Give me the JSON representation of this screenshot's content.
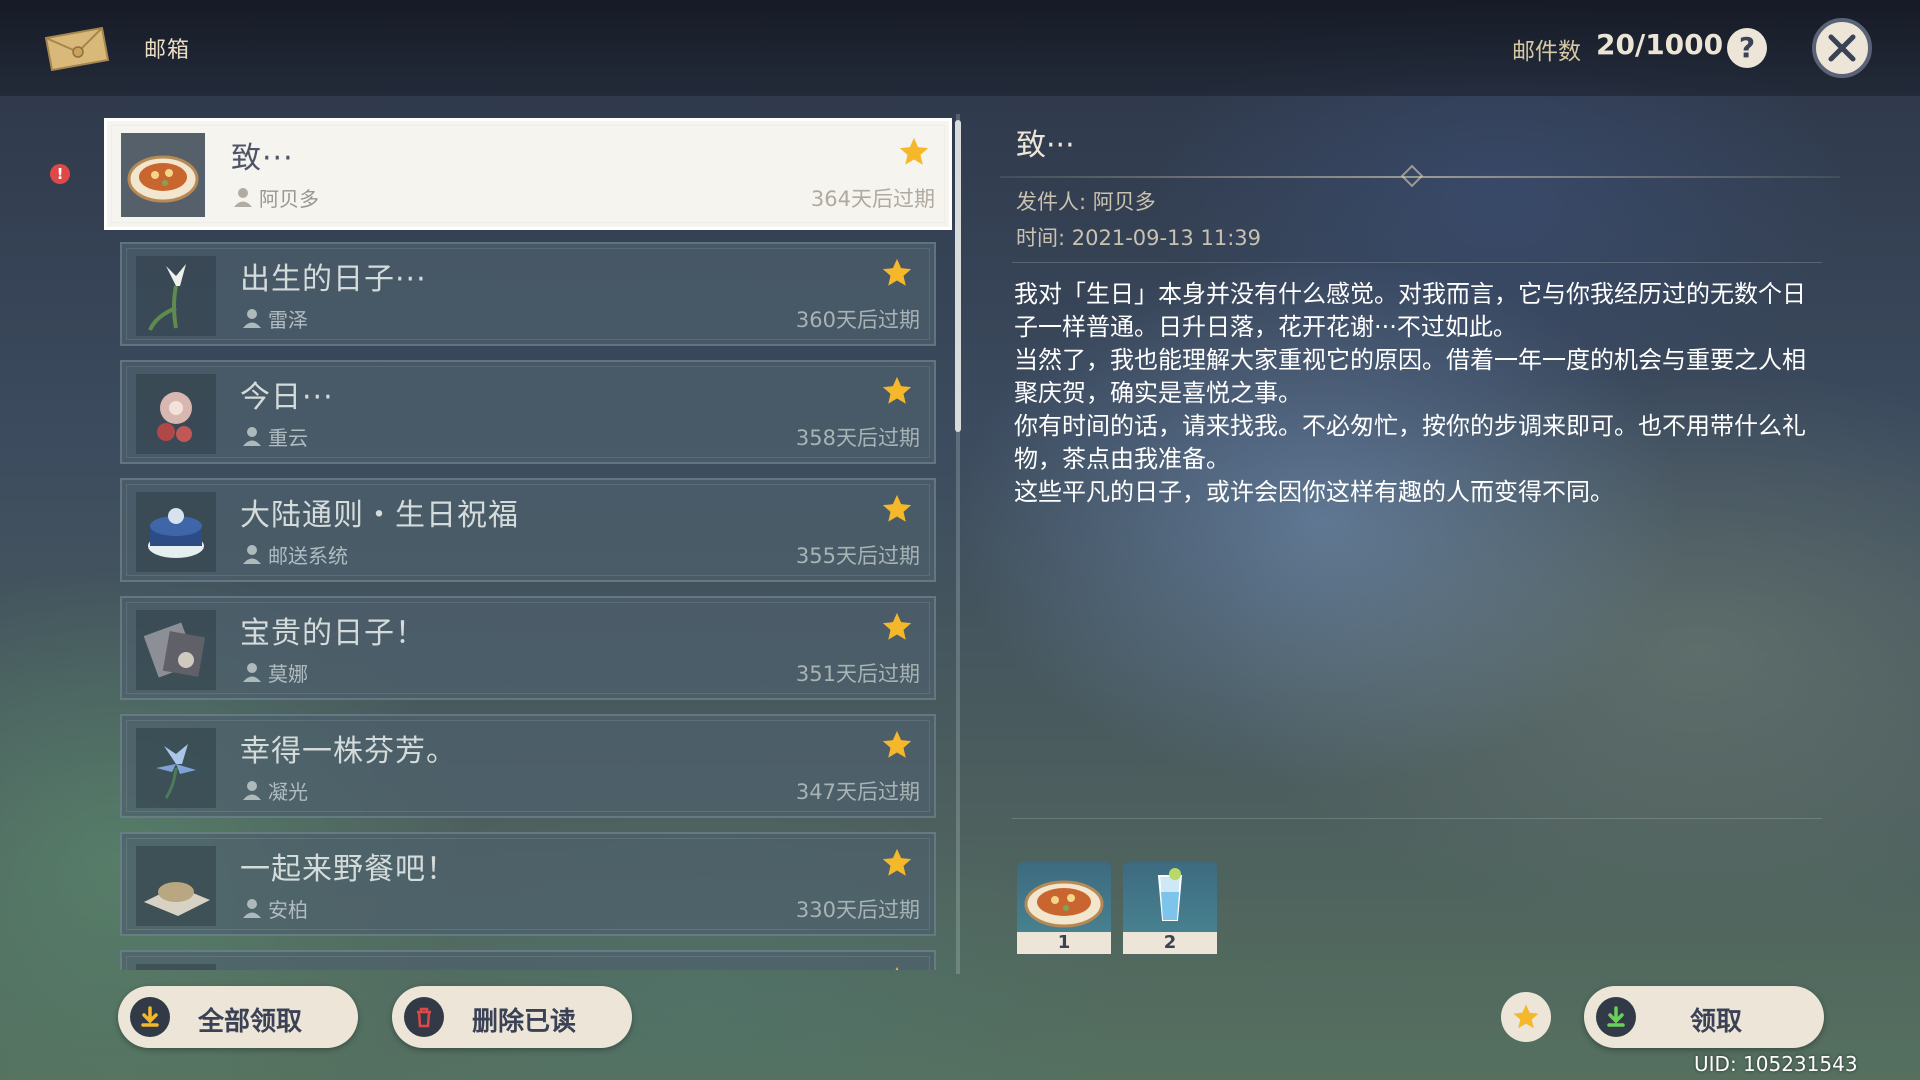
{
  "header": {
    "title": "邮箱",
    "mail_count_label": "邮件数",
    "mail_count_value": "20/1000",
    "help_icon": "question-icon",
    "close_icon": "close-icon"
  },
  "mail_list": [
    {
      "title": "致···",
      "sender": "阿贝多",
      "expire": "364天后过期",
      "starred": true,
      "selected": true,
      "thumb": "dish-icon"
    },
    {
      "title": "出生的日子···",
      "sender": "雷泽",
      "expire": "360天后过期",
      "starred": true,
      "selected": false,
      "thumb": "lily-icon"
    },
    {
      "title": "今日···",
      "sender": "重云",
      "expire": "358天后过期",
      "starred": true,
      "selected": false,
      "thumb": "flower-icon"
    },
    {
      "title": "大陆通则・生日祝福",
      "sender": "邮送系统",
      "expire": "355天后过期",
      "starred": true,
      "selected": false,
      "thumb": "cake-icon"
    },
    {
      "title": "宝贵的日子！",
      "sender": "莫娜",
      "expire": "351天后过期",
      "starred": true,
      "selected": false,
      "thumb": "film-icon"
    },
    {
      "title": "幸得一株芬芳。",
      "sender": "凝光",
      "expire": "347天后过期",
      "starred": true,
      "selected": false,
      "thumb": "glaze-lily-icon"
    },
    {
      "title": "一起来野餐吧！",
      "sender": "安柏",
      "expire": "330天后过期",
      "starred": true,
      "selected": false,
      "thumb": "picnic-icon"
    }
  ],
  "detail": {
    "title": "致···",
    "sender_line": "发件人: 阿贝多",
    "time_line": "时间: 2021-09-13 11:39",
    "paragraphs": [
      "我对「生日」本身并没有什么感觉。对我而言，它与你我经历过的无数个日子一样普通。日升日落，花开花谢···不过如此。",
      "当然了，我也能理解大家重视它的原因。借着一年一度的机会与重要之人相聚庆贺，确实是喜悦之事。",
      "你有时间的话，请来找我。不必匆忙，按你的步调来即可。也不用带什么礼物，茶点由我准备。",
      "这些平凡的日子，或许会因你这样有趣的人而变得不同。"
    ],
    "attachments": [
      {
        "icon": "dish-icon",
        "qty": "1"
      },
      {
        "icon": "drink-icon",
        "qty": "2"
      }
    ]
  },
  "buttons": {
    "claim_all": "全部领取",
    "delete_read": "删除已读",
    "claim": "领取"
  },
  "uid": "UID: 105231543",
  "colors": {
    "accent_cream": "#ece5d8",
    "star_gold": "#f5b82a",
    "alert_red": "#e04848"
  }
}
